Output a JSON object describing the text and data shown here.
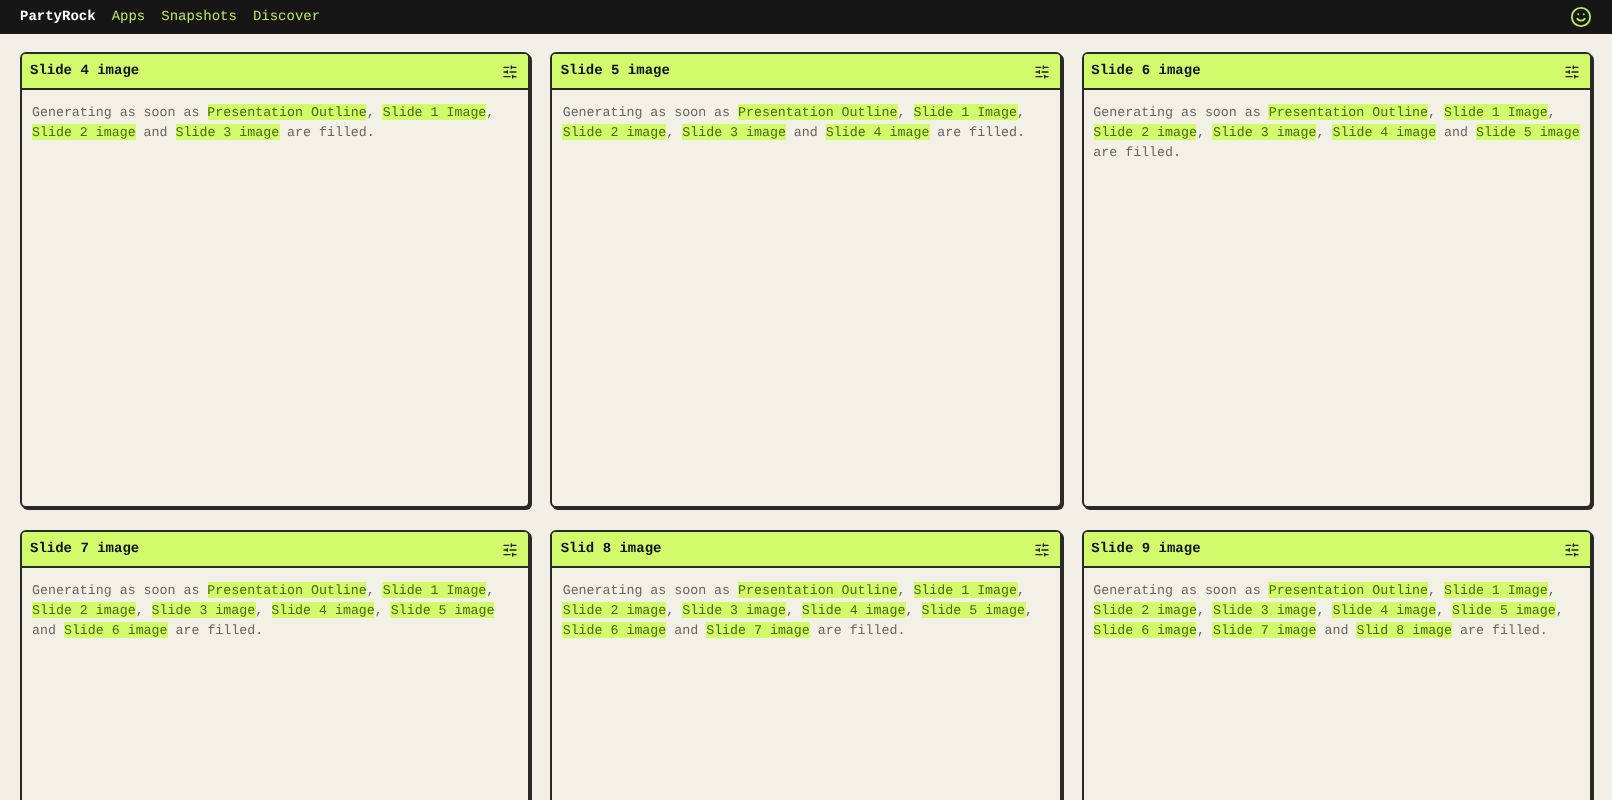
{
  "nav": {
    "brand": "PartyRock",
    "links": [
      "Apps",
      "Snapshots",
      "Discover"
    ]
  },
  "cards": [
    {
      "title": "Slide 4 image",
      "description": [
        {
          "kind": "plain",
          "text": "Generating as soon as "
        },
        {
          "kind": "ref",
          "text": "Presentation Outline"
        },
        {
          "kind": "plain",
          "text": ", "
        },
        {
          "kind": "ref",
          "text": "Slide 1 Image"
        },
        {
          "kind": "plain",
          "text": ", "
        },
        {
          "kind": "ref",
          "text": "Slide 2 image"
        },
        {
          "kind": "plain",
          "text": " and "
        },
        {
          "kind": "ref",
          "text": "Slide 3 image"
        },
        {
          "kind": "plain",
          "text": " are filled."
        }
      ]
    },
    {
      "title": "Slide 5 image",
      "description": [
        {
          "kind": "plain",
          "text": "Generating as soon as "
        },
        {
          "kind": "ref",
          "text": "Presentation Outline"
        },
        {
          "kind": "plain",
          "text": ", "
        },
        {
          "kind": "ref",
          "text": "Slide 1 Image"
        },
        {
          "kind": "plain",
          "text": ", "
        },
        {
          "kind": "ref",
          "text": "Slide 2 image"
        },
        {
          "kind": "plain",
          "text": ", "
        },
        {
          "kind": "ref",
          "text": "Slide 3 image"
        },
        {
          "kind": "plain",
          "text": " and "
        },
        {
          "kind": "ref",
          "text": "Slide 4 image"
        },
        {
          "kind": "plain",
          "text": " are filled."
        }
      ]
    },
    {
      "title": "Slide 6 image",
      "description": [
        {
          "kind": "plain",
          "text": "Generating as soon as "
        },
        {
          "kind": "ref",
          "text": "Presentation Outline"
        },
        {
          "kind": "plain",
          "text": ", "
        },
        {
          "kind": "ref",
          "text": "Slide 1 Image"
        },
        {
          "kind": "plain",
          "text": ", "
        },
        {
          "kind": "ref",
          "text": "Slide 2 image"
        },
        {
          "kind": "plain",
          "text": ", "
        },
        {
          "kind": "ref",
          "text": "Slide 3 image"
        },
        {
          "kind": "plain",
          "text": ", "
        },
        {
          "kind": "ref",
          "text": "Slide 4 image"
        },
        {
          "kind": "plain",
          "text": " and "
        },
        {
          "kind": "ref",
          "text": "Slide 5 image"
        },
        {
          "kind": "plain",
          "text": " are filled."
        }
      ]
    },
    {
      "title": "Slide 7 image",
      "description": [
        {
          "kind": "plain",
          "text": "Generating as soon as "
        },
        {
          "kind": "ref",
          "text": "Presentation Outline"
        },
        {
          "kind": "plain",
          "text": ", "
        },
        {
          "kind": "ref",
          "text": "Slide 1 Image"
        },
        {
          "kind": "plain",
          "text": ", "
        },
        {
          "kind": "ref",
          "text": "Slide 2 image"
        },
        {
          "kind": "plain",
          "text": ", "
        },
        {
          "kind": "ref",
          "text": "Slide 3 image"
        },
        {
          "kind": "plain",
          "text": ", "
        },
        {
          "kind": "ref",
          "text": "Slide 4 image"
        },
        {
          "kind": "plain",
          "text": ", "
        },
        {
          "kind": "ref",
          "text": "Slide 5 image"
        },
        {
          "kind": "plain",
          "text": " and "
        },
        {
          "kind": "ref",
          "text": "Slide 6 image"
        },
        {
          "kind": "plain",
          "text": " are filled."
        }
      ]
    },
    {
      "title": "Slid 8 image",
      "description": [
        {
          "kind": "plain",
          "text": "Generating as soon as "
        },
        {
          "kind": "ref",
          "text": "Presentation Outline"
        },
        {
          "kind": "plain",
          "text": ", "
        },
        {
          "kind": "ref",
          "text": "Slide 1 Image"
        },
        {
          "kind": "plain",
          "text": ", "
        },
        {
          "kind": "ref",
          "text": "Slide 2 image"
        },
        {
          "kind": "plain",
          "text": ", "
        },
        {
          "kind": "ref",
          "text": "Slide 3 image"
        },
        {
          "kind": "plain",
          "text": ", "
        },
        {
          "kind": "ref",
          "text": "Slide 4 image"
        },
        {
          "kind": "plain",
          "text": ", "
        },
        {
          "kind": "ref",
          "text": "Slide 5 image"
        },
        {
          "kind": "plain",
          "text": ", "
        },
        {
          "kind": "ref",
          "text": "Slide 6 image"
        },
        {
          "kind": "plain",
          "text": " and "
        },
        {
          "kind": "ref",
          "text": "Slide 7 image"
        },
        {
          "kind": "plain",
          "text": " are filled."
        }
      ]
    },
    {
      "title": "Slide 9 image",
      "description": [
        {
          "kind": "plain",
          "text": "Generating as soon as "
        },
        {
          "kind": "ref",
          "text": "Presentation Outline"
        },
        {
          "kind": "plain",
          "text": ", "
        },
        {
          "kind": "ref",
          "text": "Slide 1 Image"
        },
        {
          "kind": "plain",
          "text": ", "
        },
        {
          "kind": "ref",
          "text": "Slide 2 image"
        },
        {
          "kind": "plain",
          "text": ", "
        },
        {
          "kind": "ref",
          "text": "Slide 3 image"
        },
        {
          "kind": "plain",
          "text": ", "
        },
        {
          "kind": "ref",
          "text": "Slide 4 image"
        },
        {
          "kind": "plain",
          "text": ", "
        },
        {
          "kind": "ref",
          "text": "Slide 5 image"
        },
        {
          "kind": "plain",
          "text": ", "
        },
        {
          "kind": "ref",
          "text": "Slide 6 image"
        },
        {
          "kind": "plain",
          "text": ", "
        },
        {
          "kind": "ref",
          "text": "Slide 7 image"
        },
        {
          "kind": "plain",
          "text": " and "
        },
        {
          "kind": "ref",
          "text": "Slid 8 image"
        },
        {
          "kind": "plain",
          "text": " are filled."
        }
      ]
    }
  ]
}
